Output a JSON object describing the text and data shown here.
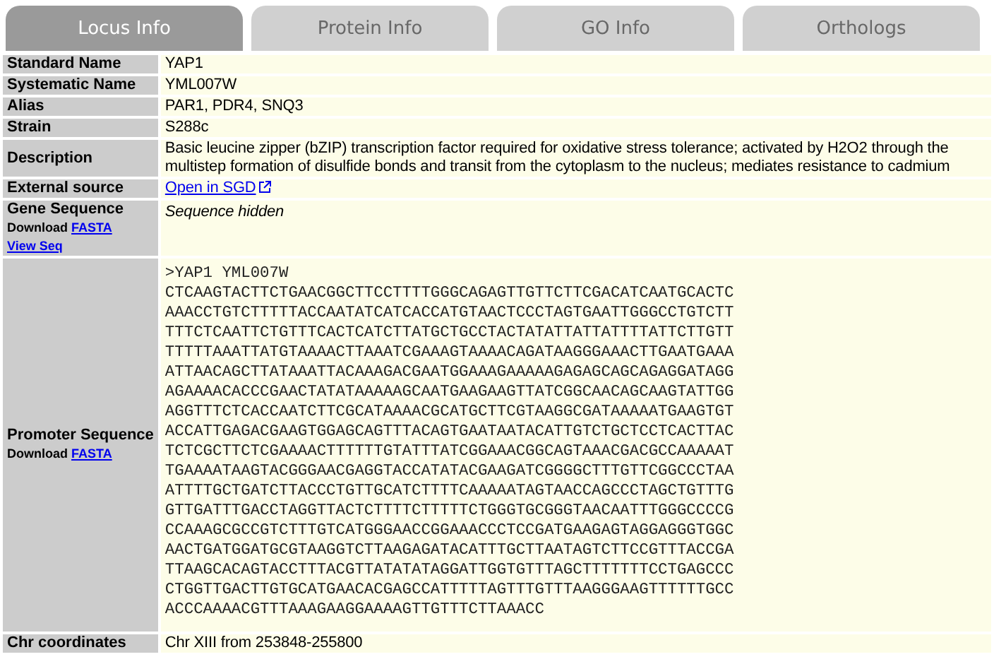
{
  "tabs": [
    {
      "label": "Locus Info",
      "selected": true
    },
    {
      "label": "Protein Info",
      "selected": false
    },
    {
      "label": "GO Info",
      "selected": false
    },
    {
      "label": "Orthologs",
      "selected": false
    }
  ],
  "rows": [
    {
      "kind": "text",
      "label": "Standard Name",
      "value": "YAP1"
    },
    {
      "kind": "text",
      "label": "Systematic Name",
      "value": "YML007W"
    },
    {
      "kind": "text",
      "label": "Alias",
      "value": "PAR1, PDR4, SNQ3"
    },
    {
      "kind": "text",
      "label": "Strain",
      "value": "S288c"
    },
    {
      "kind": "text",
      "label": "Description",
      "value": "Basic leucine zipper (bZIP) transcription factor required for oxidative stress tolerance; activated by H2O2 through the multistep formation of disulfide bonds and transit from the cytoplasm to the nucleus; mediates resistance to cadmium"
    },
    {
      "kind": "link",
      "label": "External source",
      "value": "Open in SGD"
    },
    {
      "kind": "hidden",
      "label": "Gene Sequence",
      "download": "Download",
      "link": "FASTA",
      "view": "View Seq",
      "value": "Sequence hidden"
    },
    {
      "kind": "sequence",
      "label": "Promoter Sequence",
      "download": "Download",
      "link": "FASTA",
      "header": ">YAP1 YML007W",
      "lines": [
        "CTCAAGTACTTCTGAACGGCTTCCTTTTGGGCAGAGTTGTTCTTCGACATCAATGCACTC",
        "AAACCTGTCTTTTTACCAATATCATCACCATGTAACTCCCTAGTGAATTGGGCCTGTCTT",
        "TTTCTCAATTCTGTTTCACTCATCTTATGCTGCCTACTATATTATTATTTTATTCTTGTT",
        "TTTTTAAATTATGTAAAACTTAAATCGAAAGTAAAACAGATAAGGGAAACTTGAATGAAA",
        "ATTAACAGCTTATAAATTACAAAGACGAATGGAAAGAAAAAGAGAGCAGCAGAGGATAGG",
        "AGAAAACACCCGAACTATATAAAAAGCAATGAAGAAGTTATCGGCAACAGCAAGTATTGG",
        "AGGTTTCTCACCAATCTTCGCATAAAACGCATGCTTCGTAAGGCGATAAAAATGAAGTGT",
        "ACCATTGAGACGAAGTGGAGCAGTTTACAGTGAATAATACATTGTCTGCTCCTCACTTAC",
        "TCTCGCTTCTCGAAAACTTTTTTGTATTTATCGGAAACGGCAGTAAACGACGCCAAAAAT",
        "TGAAAATAAGTACGGGAACGAGGTACCATATACGAAGATCGGGGCTTTGTTCGGCCCTAA",
        "ATTTTGCTGATCTTACCCTGTTGCATCTTTTCAAAAATAGTAACCAGCCCTAGCTGTTTG",
        "GTTGATTTGACCTAGGTTACTCTTTTCTTTTTCTGGGTGCGGGTAACAATTTGGGCCCCG",
        "CCAAAGCGCCGTCTTTGTCATGGGAACCGGAAACCCTCCGATGAAGAGTAGGAGGGTGGC",
        "AACTGATGGATGCGTAAGGTCTTAAGAGATACATTTGCTTAATAGTCTTCCGTTTACCGA",
        "TTAAGCACAGTACCTTTACGTTATATATAGGATTGGTGTTTAGCTTTTTTTCCTGAGCCC",
        "CTGGTTGACTTGTGCATGAACACGAGCCATTTTTAGTTTGTTTAAGGGAAGTTTTTTGCC",
        "ACCCAAAACGTTTAAAGAAGGAAAAGTTGTTTCTTAAACC"
      ]
    },
    {
      "kind": "text",
      "label": "Chr coordinates",
      "value": "Chr XIII from 253848-255800"
    }
  ]
}
